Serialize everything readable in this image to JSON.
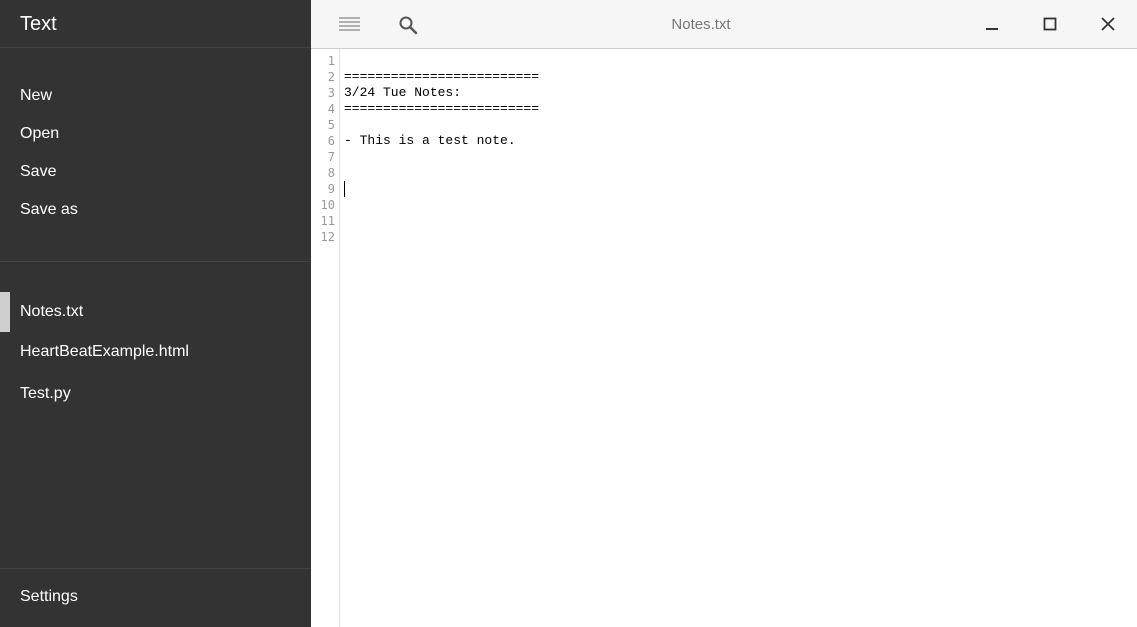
{
  "sidebar": {
    "app_title": "Text",
    "menu": {
      "new": "New",
      "open": "Open",
      "save": "Save",
      "save_as": "Save as"
    },
    "files": [
      {
        "label": "Notes.txt",
        "active": true
      },
      {
        "label": "HeartBeatExample.html",
        "active": false
      },
      {
        "label": "Test.py",
        "active": false
      }
    ],
    "settings": "Settings"
  },
  "toolbar": {
    "menu_icon": "hamburger-icon",
    "search_icon": "search-icon",
    "title": "Notes.txt",
    "window_controls": [
      "minimize-icon",
      "maximize-icon",
      "close-icon"
    ]
  },
  "editor": {
    "line_numbers": [
      "1",
      "2",
      "3",
      "4",
      "5",
      "6",
      "7",
      "8",
      "9",
      "10",
      "11",
      "12"
    ],
    "lines": [
      "",
      "=========================",
      "3/24 Tue Notes:",
      "=========================",
      "",
      "- This is a test note.",
      "",
      "",
      "",
      "",
      "",
      ""
    ],
    "cursor_line": 9
  },
  "colors": {
    "sidebar_bg": "#333333",
    "toolbar_bg": "#f6f6f6",
    "active_file_marker": "#cfcfcf",
    "line_number": "#999999"
  }
}
